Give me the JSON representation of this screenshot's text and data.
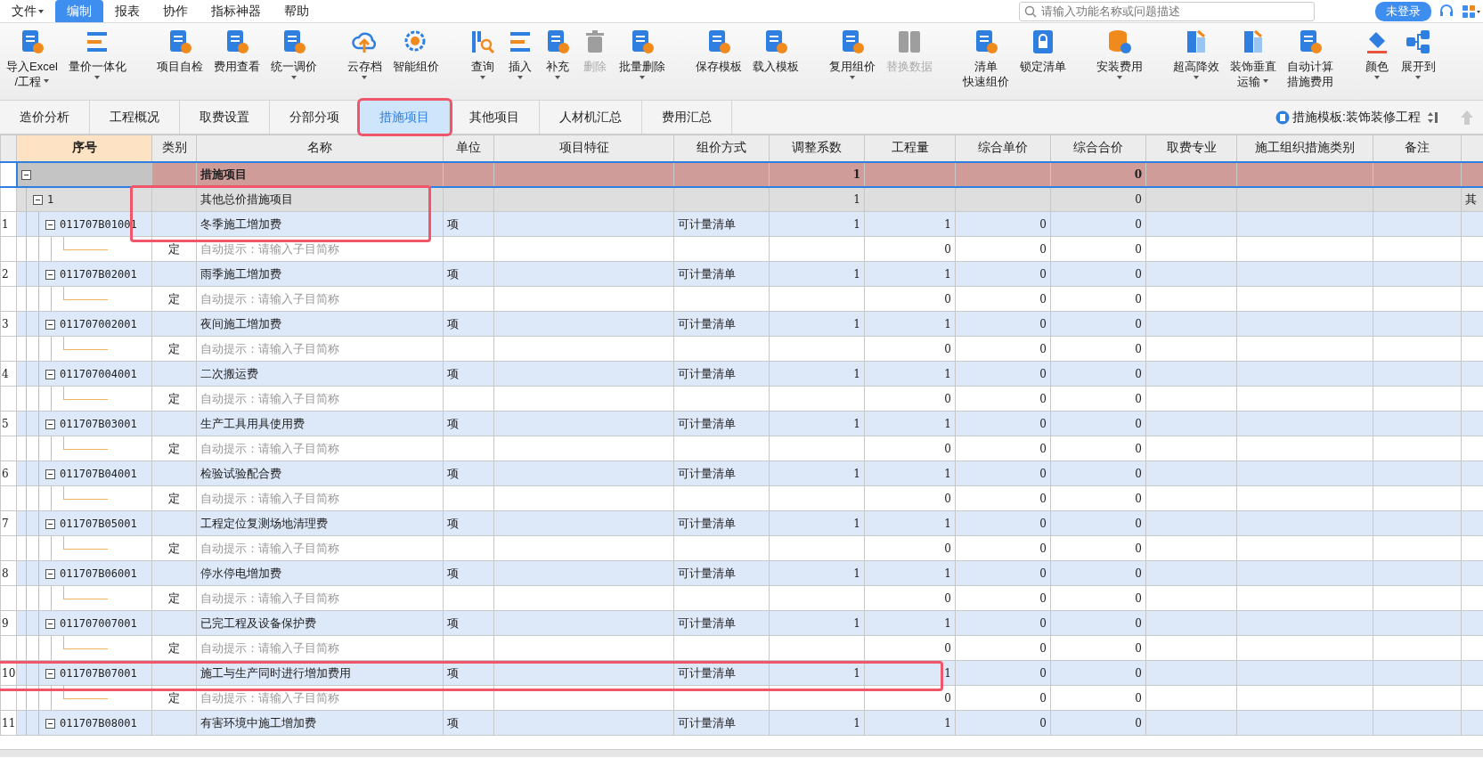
{
  "menu": [
    {
      "label": "文件",
      "dropdown": true,
      "selected": false
    },
    {
      "label": "编制",
      "dropdown": false,
      "selected": true
    },
    {
      "label": "报表",
      "dropdown": false,
      "selected": false
    },
    {
      "label": "协作",
      "dropdown": false,
      "selected": false
    },
    {
      "label": "指标神器",
      "dropdown": false,
      "selected": false
    },
    {
      "label": "帮助",
      "dropdown": false,
      "selected": false
    }
  ],
  "search": {
    "placeholder": "请输入功能名称或问题描述"
  },
  "login_button": "未登录",
  "toolbar": [
    [
      {
        "lines": [
          "导入Excel",
          "/工程"
        ],
        "kind": "doc",
        "dropdown": true,
        "disabled": false
      },
      {
        "lines": [
          "量价一体化"
        ],
        "kind": "bars",
        "dropdown": true,
        "disabled": false
      }
    ],
    [
      {
        "lines": [
          "项目自检"
        ],
        "kind": "doc",
        "dropdown": false,
        "disabled": false
      },
      {
        "lines": [
          "费用查看"
        ],
        "kind": "doc",
        "dropdown": false,
        "disabled": false
      },
      {
        "lines": [
          "统一调价"
        ],
        "kind": "doc",
        "dropdown": true,
        "disabled": false
      }
    ],
    [
      {
        "lines": [
          "云存档"
        ],
        "kind": "cloud",
        "dropdown": true,
        "disabled": false
      },
      {
        "lines": [
          "智能组价"
        ],
        "kind": "gear",
        "dropdown": false,
        "disabled": false
      }
    ],
    [
      {
        "lines": [
          "查询"
        ],
        "kind": "search",
        "dropdown": true,
        "disabled": false
      },
      {
        "lines": [
          "插入"
        ],
        "kind": "bars",
        "dropdown": true,
        "disabled": false
      },
      {
        "lines": [
          "补充"
        ],
        "kind": "doc",
        "dropdown": true,
        "disabled": false
      },
      {
        "lines": [
          "删除"
        ],
        "kind": "trash",
        "dropdown": false,
        "disabled": true
      },
      {
        "lines": [
          "批量删除"
        ],
        "kind": "doc",
        "dropdown": true,
        "disabled": false
      }
    ],
    [
      {
        "lines": [
          "保存模板"
        ],
        "kind": "doc",
        "dropdown": false,
        "disabled": false
      },
      {
        "lines": [
          "载入模板"
        ],
        "kind": "doc",
        "dropdown": false,
        "disabled": false
      }
    ],
    [
      {
        "lines": [
          "复用组价"
        ],
        "kind": "doc",
        "dropdown": true,
        "disabled": false
      },
      {
        "lines": [
          "替换数据"
        ],
        "kind": "swap",
        "dropdown": false,
        "disabled": true
      }
    ],
    [
      {
        "lines": [
          "清单",
          "快速组价"
        ],
        "kind": "doc",
        "dropdown": false,
        "disabled": false
      },
      {
        "lines": [
          "锁定清单"
        ],
        "kind": "lock",
        "dropdown": false,
        "disabled": false
      }
    ],
    [
      {
        "lines": [
          "安装费用"
        ],
        "kind": "database",
        "dropdown": true,
        "disabled": false
      }
    ],
    [
      {
        "lines": [
          "超高降效"
        ],
        "kind": "building",
        "dropdown": true,
        "disabled": false
      },
      {
        "lines": [
          "装饰垂直",
          "运输"
        ],
        "kind": "building",
        "dropdown": true,
        "disabled": false
      },
      {
        "lines": [
          "自动计算",
          "措施费用"
        ],
        "kind": "doc",
        "dropdown": false,
        "disabled": false
      }
    ],
    [
      {
        "lines": [
          "颜色"
        ],
        "kind": "bucket",
        "dropdown": true,
        "disabled": false
      },
      {
        "lines": [
          "展开到"
        ],
        "kind": "nodes",
        "dropdown": true,
        "disabled": false
      }
    ]
  ],
  "tabs": [
    {
      "label": "造价分析",
      "selected": false,
      "highlighted": false
    },
    {
      "label": "工程概况",
      "selected": false,
      "highlighted": false
    },
    {
      "label": "取费设置",
      "selected": false,
      "highlighted": false
    },
    {
      "label": "分部分项",
      "selected": false,
      "highlighted": false
    },
    {
      "label": "措施项目",
      "selected": true,
      "highlighted": true
    },
    {
      "label": "其他项目",
      "selected": false,
      "highlighted": false
    },
    {
      "label": "人材机汇总",
      "selected": false,
      "highlighted": false
    },
    {
      "label": "费用汇总",
      "selected": false,
      "highlighted": false
    }
  ],
  "template_label": "措施模板:装饰装修工程",
  "table": {
    "columns": [
      "序号",
      "类别",
      "名称",
      "单位",
      "项目特征",
      "组价方式",
      "调整系数",
      "工程量",
      "综合单价",
      "综合合价",
      "取费专业",
      "施工组织措施类别",
      "备注"
    ],
    "rows": [
      {
        "kind": "root",
        "selected": true,
        "expanded": true,
        "name": "措施项目",
        "coef": "1",
        "total": "0",
        "children": [
          {
            "kind": "group",
            "selected": false,
            "expanded": true,
            "code": "1",
            "name": "其他总价措施项目",
            "coef": "1",
            "total": "0",
            "extra": "其",
            "highlighted": true,
            "children": [
              {
                "kind": "item",
                "selected": false,
                "expanded": true,
                "num": "1",
                "code": "011707B01001",
                "name": "冬季施工增加费",
                "unit": "项",
                "method": "可计量清单",
                "coef": "1",
                "qty": "1",
                "price": "0",
                "total": "0",
                "highlighted": true,
                "children": [
                  {
                    "kind": "sub",
                    "selected": false,
                    "type": "定",
                    "hint": "自动提示：请输入子目简称",
                    "qty": "0",
                    "price": "0",
                    "total": "0"
                  }
                ]
              },
              {
                "kind": "item",
                "selected": false,
                "expanded": true,
                "num": "2",
                "code": "011707B02001",
                "name": "雨季施工增加费",
                "unit": "项",
                "method": "可计量清单",
                "coef": "1",
                "qty": "1",
                "price": "0",
                "total": "0",
                "children": [
                  {
                    "kind": "sub",
                    "selected": false,
                    "type": "定",
                    "hint": "自动提示：请输入子目简称",
                    "qty": "0",
                    "price": "0",
                    "total": "0"
                  }
                ]
              },
              {
                "kind": "item",
                "selected": false,
                "expanded": true,
                "num": "3",
                "code": "011707002001",
                "name": "夜间施工增加费",
                "unit": "项",
                "method": "可计量清单",
                "coef": "1",
                "qty": "1",
                "price": "0",
                "total": "0",
                "children": [
                  {
                    "kind": "sub",
                    "selected": false,
                    "type": "定",
                    "hint": "自动提示：请输入子目简称",
                    "qty": "0",
                    "price": "0",
                    "total": "0"
                  }
                ]
              },
              {
                "kind": "item",
                "selected": false,
                "expanded": true,
                "num": "4",
                "code": "011707004001",
                "name": "二次搬运费",
                "unit": "项",
                "method": "可计量清单",
                "coef": "1",
                "qty": "1",
                "price": "0",
                "total": "0",
                "children": [
                  {
                    "kind": "sub",
                    "selected": false,
                    "type": "定",
                    "hint": "自动提示：请输入子目简称",
                    "qty": "0",
                    "price": "0",
                    "total": "0"
                  }
                ]
              },
              {
                "kind": "item",
                "selected": false,
                "expanded": true,
                "num": "5",
                "code": "011707B03001",
                "name": "生产工具用具使用费",
                "unit": "项",
                "method": "可计量清单",
                "coef": "1",
                "qty": "1",
                "price": "0",
                "total": "0",
                "children": [
                  {
                    "kind": "sub",
                    "selected": false,
                    "type": "定",
                    "hint": "自动提示：请输入子目简称",
                    "qty": "0",
                    "price": "0",
                    "total": "0"
                  }
                ]
              },
              {
                "kind": "item",
                "selected": false,
                "expanded": true,
                "num": "6",
                "code": "011707B04001",
                "name": "检验试验配合费",
                "unit": "项",
                "method": "可计量清单",
                "coef": "1",
                "qty": "1",
                "price": "0",
                "total": "0",
                "children": [
                  {
                    "kind": "sub",
                    "selected": false,
                    "type": "定",
                    "hint": "自动提示：请输入子目简称",
                    "qty": "0",
                    "price": "0",
                    "total": "0"
                  }
                ]
              },
              {
                "kind": "item",
                "selected": false,
                "expanded": true,
                "num": "7",
                "code": "011707B05001",
                "name": "工程定位复测场地清理费",
                "unit": "项",
                "method": "可计量清单",
                "coef": "1",
                "qty": "1",
                "price": "0",
                "total": "0",
                "children": [
                  {
                    "kind": "sub",
                    "selected": false,
                    "type": "定",
                    "hint": "自动提示：请输入子目简称",
                    "qty": "0",
                    "price": "0",
                    "total": "0"
                  }
                ]
              },
              {
                "kind": "item",
                "selected": false,
                "expanded": true,
                "num": "8",
                "code": "011707B06001",
                "name": "停水停电增加费",
                "unit": "项",
                "method": "可计量清单",
                "coef": "1",
                "qty": "1",
                "price": "0",
                "total": "0",
                "children": [
                  {
                    "kind": "sub",
                    "selected": false,
                    "type": "定",
                    "hint": "自动提示：请输入子目简称",
                    "qty": "0",
                    "price": "0",
                    "total": "0"
                  }
                ]
              },
              {
                "kind": "item",
                "selected": false,
                "expanded": true,
                "num": "9",
                "code": "011707007001",
                "name": "已完工程及设备保护费",
                "unit": "项",
                "method": "可计量清单",
                "coef": "1",
                "qty": "1",
                "price": "0",
                "total": "0",
                "children": [
                  {
                    "kind": "sub",
                    "selected": false,
                    "type": "定",
                    "hint": "自动提示：请输入子目简称",
                    "qty": "0",
                    "price": "0",
                    "total": "0"
                  }
                ]
              },
              {
                "kind": "item",
                "selected": false,
                "expanded": true,
                "num": "10",
                "code": "011707B07001",
                "name": "施工与生产同时进行增加费用",
                "unit": "项",
                "method": "可计量清单",
                "coef": "1",
                "qty": "1",
                "price": "0",
                "total": "0",
                "highlighted": true,
                "children": [
                  {
                    "kind": "sub",
                    "selected": false,
                    "type": "定",
                    "hint": "自动提示：请输入子目简称",
                    "qty": "0",
                    "price": "0",
                    "total": "0"
                  }
                ]
              },
              {
                "kind": "item",
                "selected": false,
                "expanded": true,
                "num": "11",
                "code": "011707B08001",
                "name": "有害环境中施工增加费",
                "unit": "项",
                "method": "可计量清单",
                "coef": "1",
                "qty": "1",
                "price": "0",
                "total": "0"
              }
            ]
          }
        ]
      }
    ]
  }
}
